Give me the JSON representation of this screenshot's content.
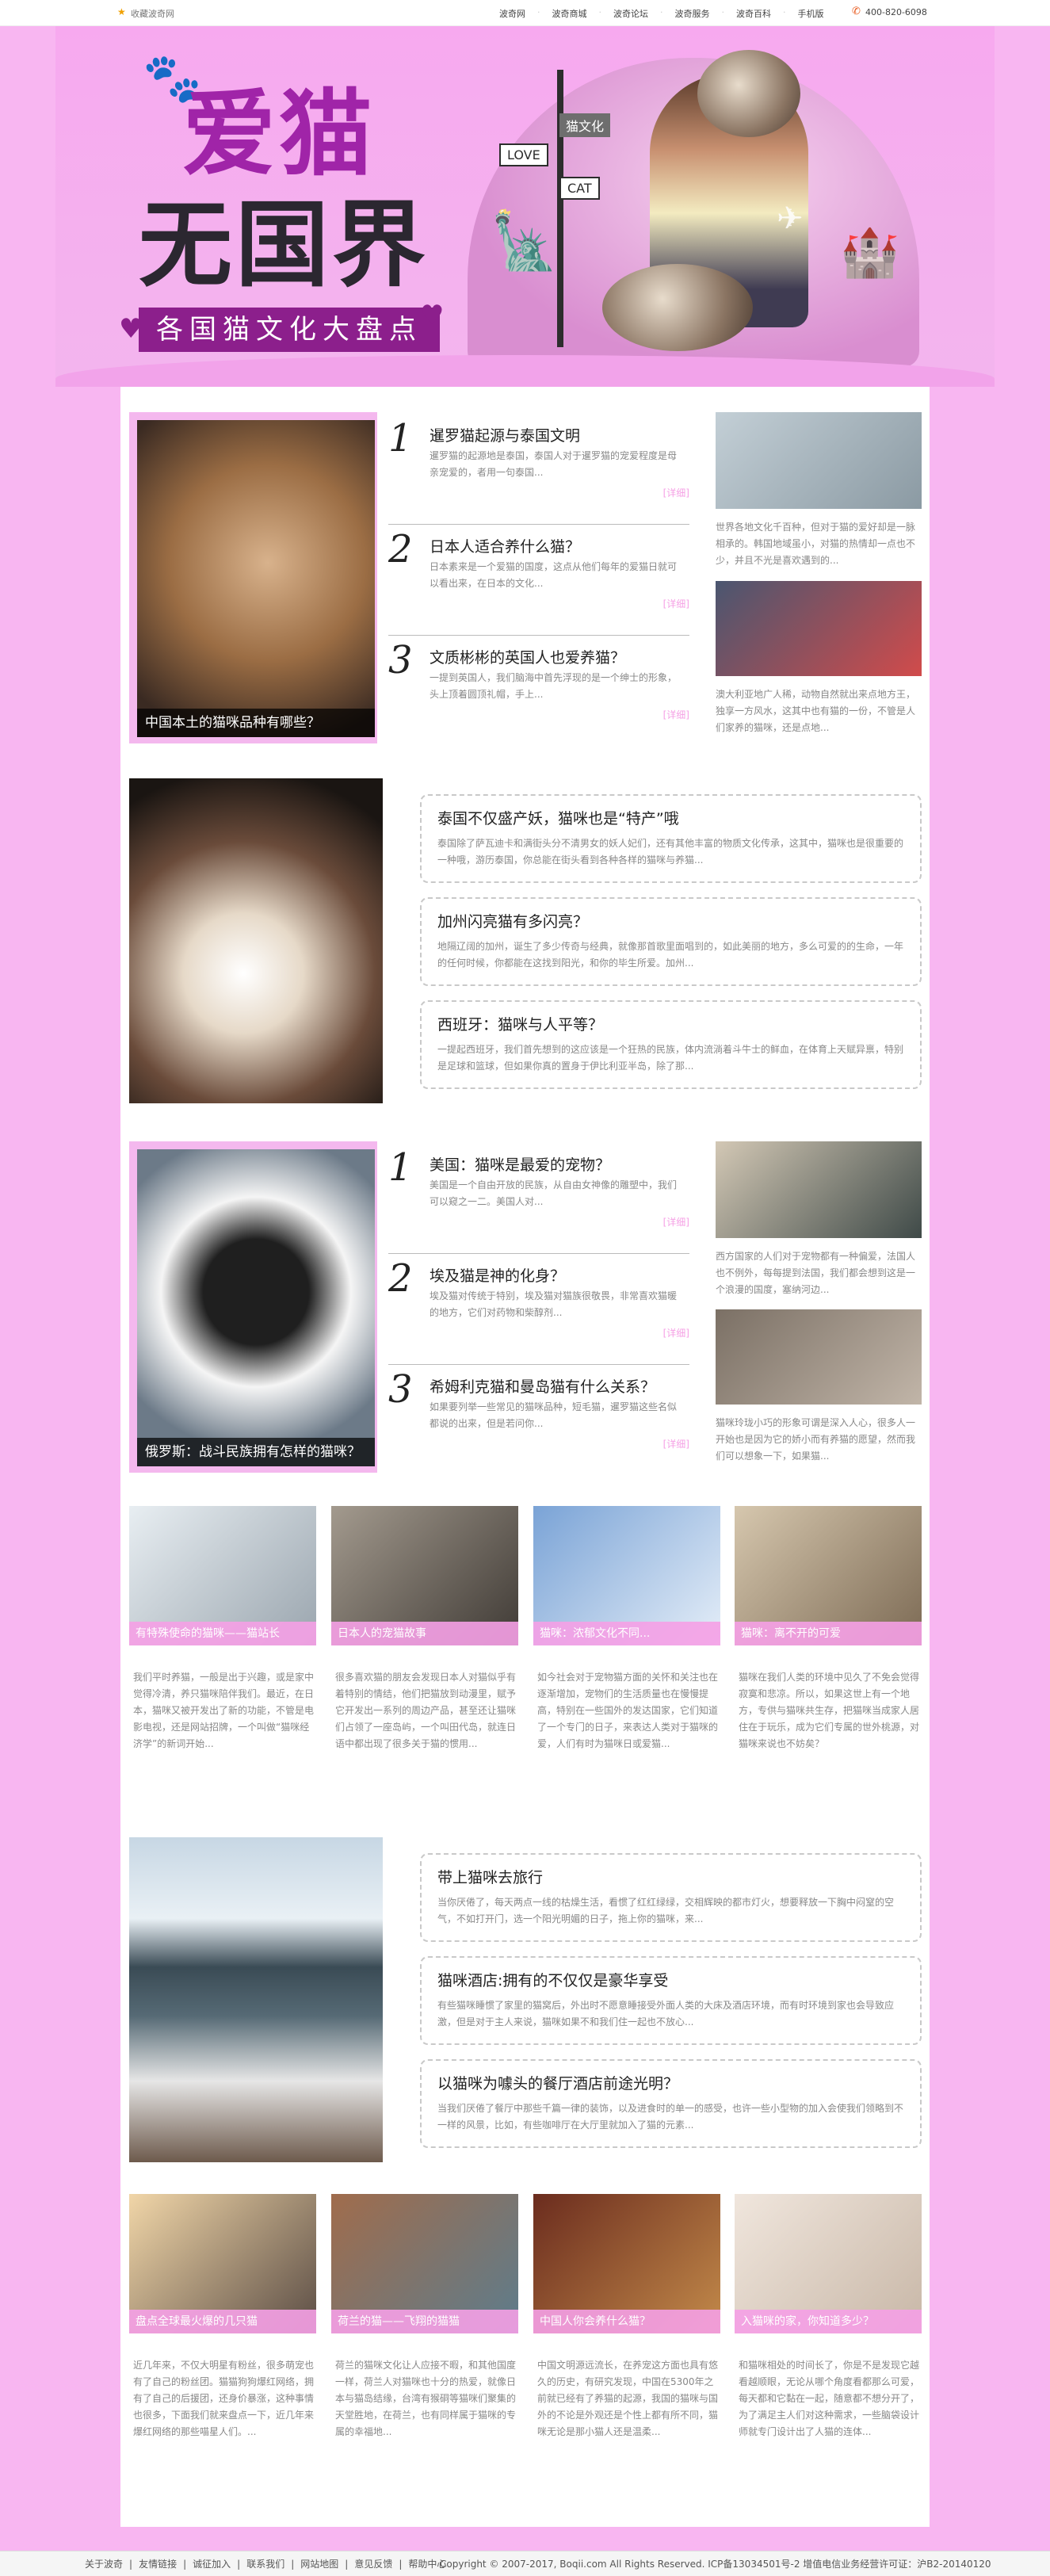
{
  "topbar": {
    "favorite": "收藏波奇网",
    "nav": [
      "波奇网",
      "波奇商城",
      "波奇论坛",
      "波奇服务",
      "波奇百科",
      "手机版"
    ],
    "phone": "400-820-6098"
  },
  "banner": {
    "title_line1": "爱猫",
    "title_line2": "无国界",
    "subtitle": "各国猫文化大盘点",
    "signs": [
      "猫文化",
      "LOVE",
      "CAT"
    ]
  },
  "section1": {
    "photo_caption": "中国本土的猫咪品种有哪些？",
    "items": [
      {
        "num": "1",
        "title": "暹罗猫起源与泰国文明",
        "desc": "暹罗猫的起源地是泰国，泰国人对于暹罗猫的宠爱程度是母亲宠爱的，者用一句泰国...",
        "more": "[详细]"
      },
      {
        "num": "2",
        "title": "日本人适合养什么猫？",
        "desc": "日本素来是一个爱猫的国度，这点从他们每年的爱猫日就可以看出来，在日本的文化...",
        "more": "[详细]"
      },
      {
        "num": "3",
        "title": "文质彬彬的英国人也爱养猫？",
        "desc": "一提到英国人，我们脑海中首先浮现的是一个绅士的形象，头上顶着圆顶礼帽，手上...",
        "more": "[详细]"
      }
    ],
    "side": [
      {
        "desc": "世界各地文化千百种，但对于猫的爱好却是一脉相承的。韩国地域虽小，对猫的热情却一点也不少，并且不光是喜欢遇到的..."
      },
      {
        "desc": "澳大利亚地广人稀，动物自然就出来点地方王，独享一方风水，这其中也有猫的一份，不管是人们家养的猫咪，还是点地..."
      }
    ]
  },
  "section2": {
    "items": [
      {
        "title": "泰国不仅盛产妖，猫咪也是“特产”哦",
        "desc": "泰国除了萨瓦迪卡和满街头分不清男女的妖人妃们，还有其他丰富的物质文化传承，这其中，猫咪也是很重要的一种哦，游历泰国，你总能在街头看到各种各样的猫咪与养猫..."
      },
      {
        "title": "加州闪亮猫有多闪亮？",
        "desc": "地隔辽阔的加州，诞生了多少传奇与经典，就像那首歌里面唱到的，如此美丽的地方，多么可爱的的生命，一年的任何时候，你都能在这找到阳光，和你的毕生所爱。加州..."
      },
      {
        "title": "西班牙：猫咪与人平等？",
        "desc": "一提起西班牙，我们首先想到的这应该是一个狂热的民族，体内流淌着斗牛士的鲜血，在体育上天赋异禀，特别是足球和篮球，但如果你真的置身于伊比利亚半岛，除了那..."
      }
    ]
  },
  "section3": {
    "photo_caption": "俄罗斯：战斗民族拥有怎样的猫咪？",
    "items": [
      {
        "num": "1",
        "title": "美国：猫咪是最爱的宠物？",
        "desc": "美国是一个自由开放的民族，从自由女神像的雕塑中，我们可以窥之一二。美国人对...",
        "more": "[详细]"
      },
      {
        "num": "2",
        "title": "埃及猫是神的化身？",
        "desc": "埃及猫对传统于特别，埃及猫对猫族很敬畏，非常喜欢猫暖的地方，它们对药物和柴醇剂...",
        "more": "[详细]"
      },
      {
        "num": "3",
        "title": "希姆利克猫和曼岛猫有什么关系？",
        "desc": "如果要列举一些常见的猫咪品种，短毛猫，暹罗猫这些名似都说的出来，但是若问你...",
        "more": "[详细]"
      }
    ],
    "side": [
      {
        "desc": "西方国家的人们对于宠物都有一种偏爱，法国人也不例外，每每提到法国，我们都会想到这是一个浪漫的国度，塞纳河边..."
      },
      {
        "desc": "猫咪玲珑小巧的形象可谓是深入人心，很多人一开始也是因为它的娇小而有养猫的愿望，然而我们可以想象一下，如果猫..."
      }
    ]
  },
  "cards1": [
    {
      "caption": "有特殊使命的猫咪——猫站长",
      "desc": "我们平时养猫，一般是出于兴趣，或是家中觉得冷清，养只猫咪陪伴我们。最近，在日本，猫咪又被开发出了新的功能，不管是电影电视，还是网站招牌，一个叫做“猫咪经济学”的新词开始..."
    },
    {
      "caption": "日本人的宠猫故事",
      "desc": "很多喜欢猫的朋友会发现日本人对猫似乎有着特别的情结，他们把猫放到动漫里，赋予它开发出一系列的周边产品，甚至还让猫咪们占领了一座岛屿，一个叫田代岛，就连日语中都出现了很多关于猫的惯用..."
    },
    {
      "caption": "猫咪：浓郁文化不同...",
      "desc": "如今社会对于宠物猫方面的关怀和关注也在逐渐增加，宠物们的生活质量也在慢慢提高，特别在一些国外的发达国家，它们知道了一个专门的日子，来表达人类对于猫咪的爱，人们有时为猫咪日或爱猫..."
    },
    {
      "caption": "猫咪：离不开的可爱",
      "desc": "猫咪在我们人类的环境中见久了不免会觉得寂寞和悲凉。所以，如果这世上有一个地方，专供与猫咪共生存，把猫咪当成家人居住在于玩乐，成为它们专属的世外桃源，对猫咪来说也不妨矣？"
    }
  ],
  "section4": {
    "items": [
      {
        "title": "带上猫咪去旅行",
        "desc": "当你厌倦了，每天两点一线的枯燥生活，看惯了红红绿绿，交相辉映的都市灯火，想要释放一下胸中闷窒的空气，不如打开门，选一个阳光明媚的日子，拖上你的猫咪，来..."
      },
      {
        "title": "猫咪酒店:拥有的不仅仅是豪华享受",
        "desc": "有些猫咪睡惯了家里的猫窝后，外出时不愿意睡接受外面人类的大床及酒店环境，而有时环境到家也会导致应激，但是对于主人来说，猫咪如果不和我们住一起也不放心..."
      },
      {
        "title": "以猫咪为噱头的餐厅酒店前途光明？",
        "desc": "当我们厌倦了餐厅中那些千篇一律的装饰，以及进食时的单一的感受，也许一些小型物的加入会使我们领略到不一样的风景，比如，有些咖啡厅在大厅里就加入了猫的元素..."
      }
    ]
  },
  "cards2": [
    {
      "caption": "盘点全球最火爆的几只猫",
      "desc": "近几年来，不仅大明星有粉丝，很多萌宠也有了自己的粉丝团。猫猫狗狗爆红网络，拥有了自己的后援团，还身价暴涨，这种事情也很多，下面我们就来盘点一下，近几年来爆红网络的那些喵星人们。..."
    },
    {
      "caption": "荷兰的猫——飞翔的猫猫",
      "desc": "荷兰的猫咪文化让人应接不暇，和其他国度一样，荷兰人对猫咪也十分的热爱，就像日本与猫岛结缘，台湾有猴硐等猫咪们聚集的天堂胜地，在荷兰，也有同样属于猫咪的专属的幸福地..."
    },
    {
      "caption": "中国人你会养什么猫？",
      "desc": "中国文明源远流长，在养宠这方面也具有悠久的历史，有研究发现，中国在5300年之前就已经有了养猫的起源，我国的猫咪与国外的不论是外观还是个性上都有所不同，猫咪无论是那小猫人还是温柔..."
    },
    {
      "caption": "入猫咪的家，你知道多少？",
      "desc": "和猫咪相处的时间长了，你是不是发现它越看越顺眼，无论从哪个角度看都那么可爱，每天都和它黏在一起，随意都不想分开了，为了满足主人们对这种需求，一些脑袋设计师就专门设计出了人猫的连体..."
    }
  ],
  "footer": {
    "links": [
      "关于波奇",
      "友情链接",
      "诚征加入",
      "联系我们",
      "网站地图",
      "意见反馈",
      "帮助中心"
    ],
    "copyright": "Copyright © 2007-2017, Boqii.com All Rights Reserved. ICP备13034501号-2 增值电信业务经营许可证：沪B2-20140120"
  }
}
